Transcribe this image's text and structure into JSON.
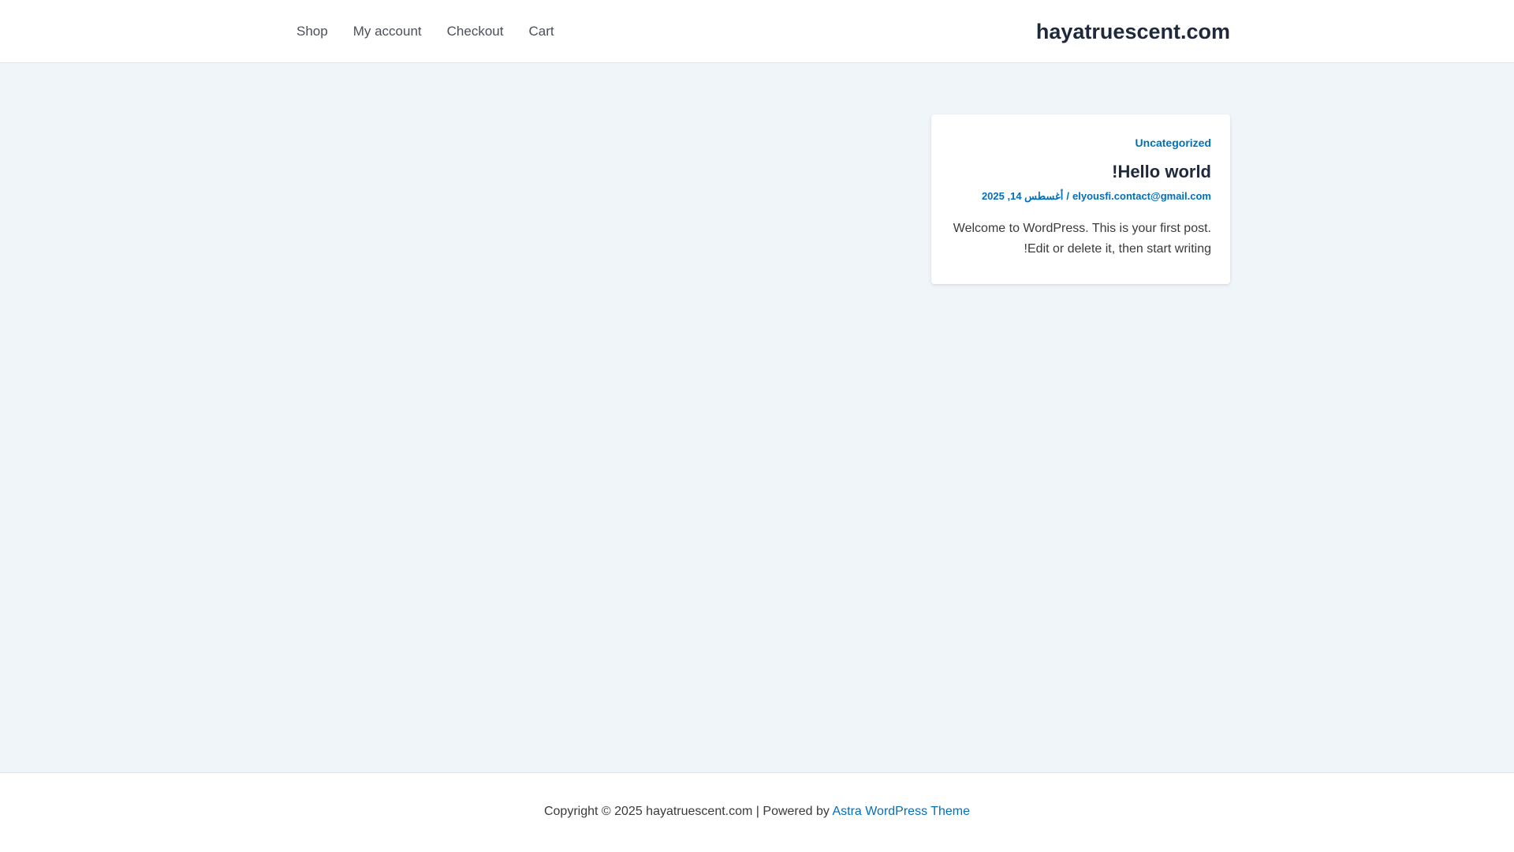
{
  "header": {
    "nav": [
      {
        "label": "Shop"
      },
      {
        "label": "My account"
      },
      {
        "label": "Checkout"
      },
      {
        "label": "Cart"
      }
    ],
    "site_title": "hayatruescent.com"
  },
  "post": {
    "category": "Uncategorized",
    "title": "Hello world!",
    "meta": {
      "author": "elyousfi.contact@gmail.com",
      "separator": "/",
      "date": "أغسطس 14, 2025"
    },
    "excerpt_line1": "Welcome to WordPress. This is your first post.",
    "excerpt_line2": "Edit or delete it, then start writing!"
  },
  "footer": {
    "copyright": "Copyright © 2025 hayatruescent.com | Powered by",
    "theme_link": "Astra WordPress Theme"
  },
  "colors": {
    "background": "#f0f5fa",
    "link": "#0170b9",
    "heading": "#1e293b"
  }
}
